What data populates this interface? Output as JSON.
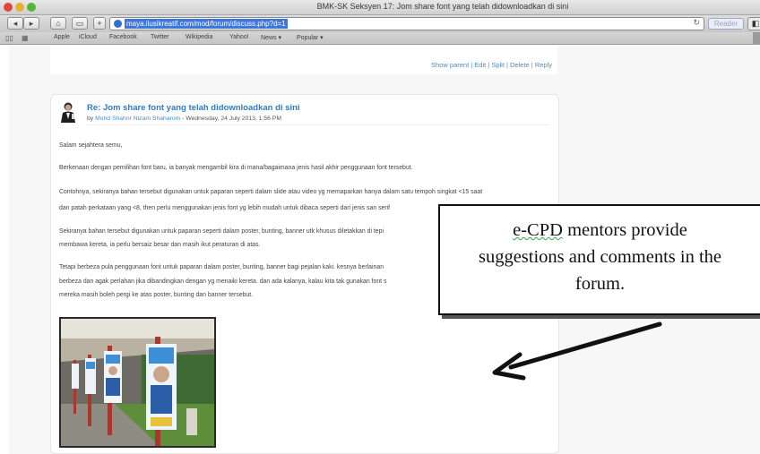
{
  "browser": {
    "window_title": "BMK-SK Seksyen 17: Jom share font yang telah didownloadkan di sini",
    "url": "maya.ilusikreatif.com/mod/forum/discuss.php?d=1",
    "reader_label": "Reader",
    "bookmarks": [
      "Apple",
      "iCloud",
      "Facebook",
      "Twitter",
      "Wikipedia",
      "Yahoo!",
      "News ▾",
      "Popular ▾"
    ]
  },
  "forum": {
    "command_links": "Show parent | Edit | Split | Delete | Reply",
    "post": {
      "subject": "Re: Jom share font yang telah didownloadkan di sini",
      "by_prefix": "by",
      "author": "Mohd Shahrir Nizam Shaharom",
      "date": " - Wednesday, 24 July 2013, 1:56 PM",
      "paragraphs": [
        "Salam sejahtera semu,",
        "Berkenaan dengan pemilihan font baru, ia banyak mengambil kira di mana/bagaimana jenis hasil akhir penggunaan font tersebut.",
        "Contohnya, sekiranya bahan tersebut digunakan untuk paparan seperti dalam slide atau video yg memaparkan hanya dalam satu tempoh singkat <15 saat",
        "dan patah perkataan yang <8, then perlu menggunakan jenis font yg lebih mudah untuk dibaca seperti dari jenis san serif",
        "Sekiranya bahan tersebut digunakan untuk paparan seperti dalam poster, bunting, banner utk khusus diletakkan di tepi",
        "membawa kereta, ia perlu bersaiz besar dan masih ikut peraturan di atas.",
        "Tetapi berbeza pula penggunaan font untuk paparan dalam poster, bunting, banner bagi pejalan kaki. kesnya berlainan",
        "berbeza dan agak perlahan jika dibandingkan dengan yg menaiki kereta. dan ada kalanya, kalau kita tak gunakan font s",
        "mereka masih boleh pergi ke atas poster, bunting dan banner tersebut."
      ]
    }
  },
  "callout": {
    "line1_word": "e-CPD",
    "line1_rest": " mentors provide",
    "line2": "suggestions and comments in the",
    "line3": "forum."
  },
  "colors": {
    "link": "#4a8cc9",
    "subject": "#2f7bc6",
    "url_highlight": "#3f76d9"
  }
}
